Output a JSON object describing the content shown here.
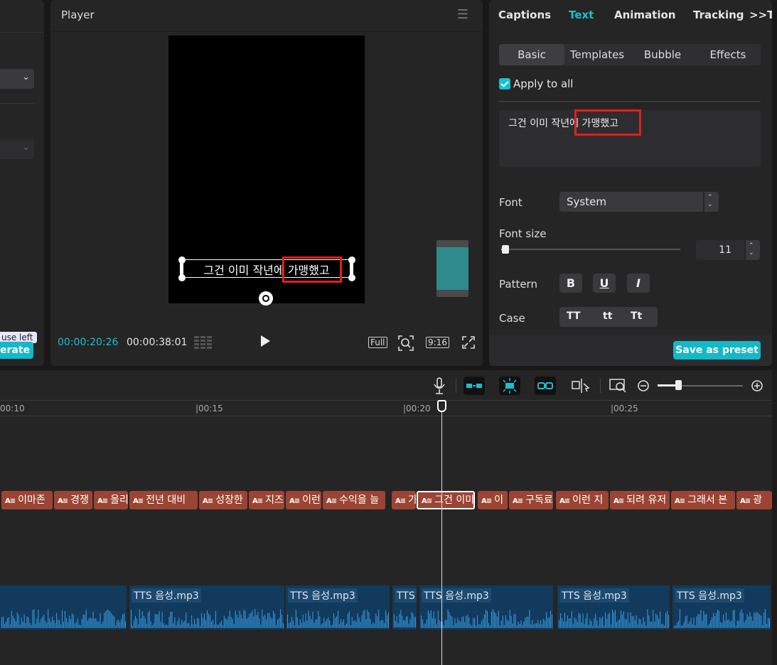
{
  "left_panel": {
    "tooltip": "use left",
    "generate_label": "erate"
  },
  "player": {
    "title": "Player",
    "caption_text": "그건 이미 작년에 가맹했고",
    "time_current": "00:00:20:26",
    "time_total": "00:00:38:01",
    "full_label": "Full",
    "ratio_label": "9:16"
  },
  "inspector": {
    "tabs": [
      "Captions",
      "Text",
      "Animation",
      "Tracking",
      ">>Te"
    ],
    "active_tab": "Text",
    "subtabs": [
      "Basic",
      "Templates",
      "Bubble",
      "Effects"
    ],
    "active_subtab": "Basic",
    "apply_to_all_label": "Apply to all",
    "apply_to_all_checked": true,
    "text_value": "그건 이미 작년에 가맹했고",
    "font_label": "Font",
    "font_value": "System",
    "font_size_label": "Font size",
    "font_size_value": "11",
    "pattern_label": "Pattern",
    "pattern_buttons": [
      "B",
      "U",
      "I"
    ],
    "case_label": "Case",
    "case_buttons": [
      "TT",
      "tt",
      "Tt"
    ],
    "save_preset_label": "Save as preset",
    "accent_color": "#19c0d0",
    "highlight_color": "#e02020"
  },
  "timeline": {
    "ruler_labels": [
      "00:10",
      "|00:15",
      "|00:20",
      "|00:25"
    ],
    "caption_clips": [
      "이마존",
      "경쟁",
      "올리",
      "전년 대비",
      "성장한",
      "지즈",
      "이런",
      "수익을 늘",
      "가",
      "그건 이미",
      "이",
      "구독료",
      "이런 지",
      "되려 유저",
      "그래서 본",
      "광"
    ],
    "audio_clips": [
      "",
      "TTS 음성.mp3",
      "TTS 음성.mp3",
      "TTS 음",
      "TTS 음성.mp3",
      "TTS 음성.mp3",
      "TTS 음성.mp3"
    ],
    "clip_color": "#9c4433",
    "audio_color": "#123a5c"
  }
}
